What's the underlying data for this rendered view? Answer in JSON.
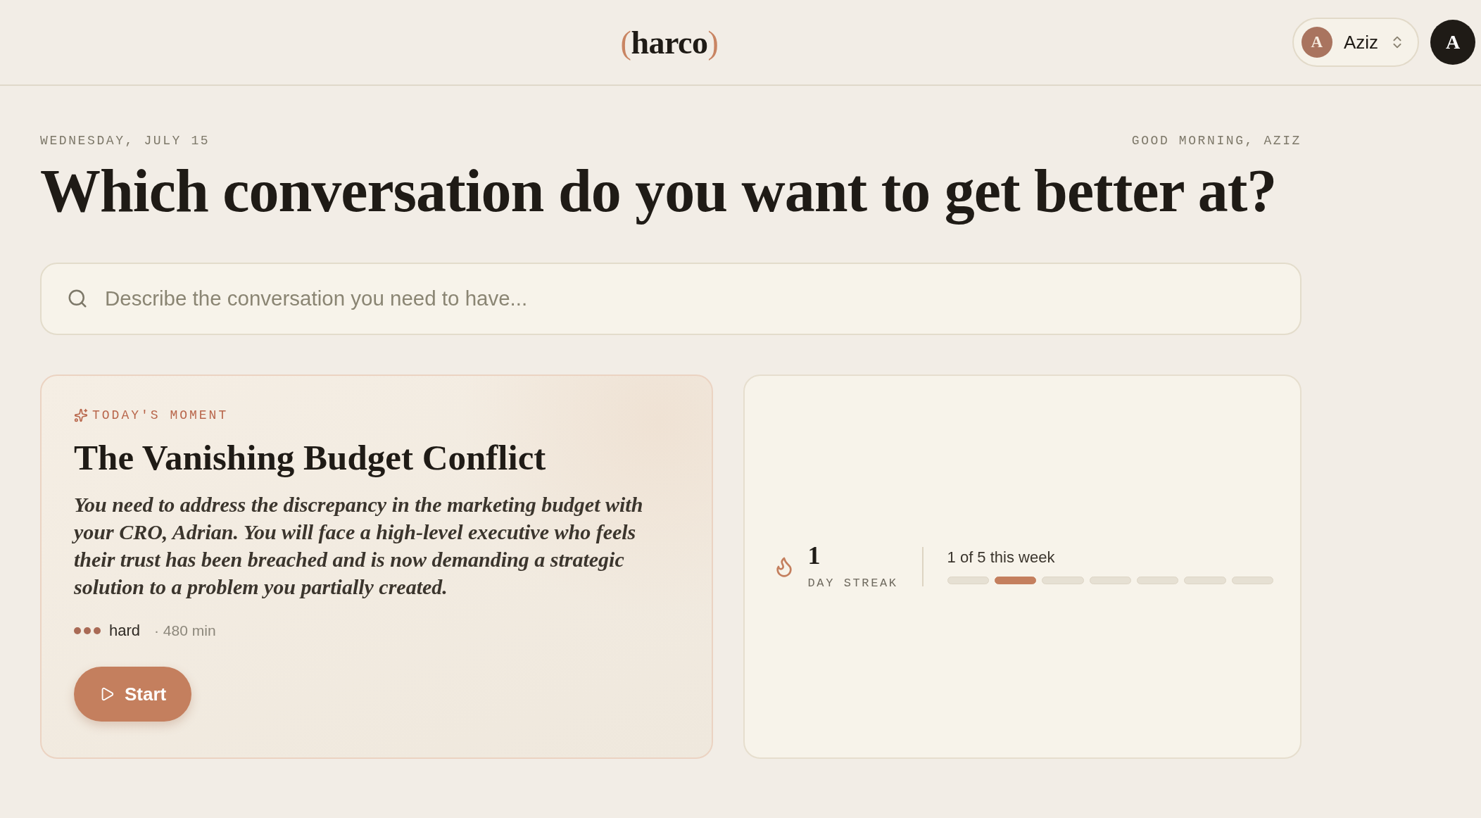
{
  "header": {
    "logo": {
      "open": "(",
      "word": "harco",
      "close": ")"
    },
    "user_switcher": {
      "initial": "A",
      "name": "Aziz"
    },
    "avatar": {
      "initial": "A"
    }
  },
  "intro": {
    "date": "WEDNESDAY, JULY 15",
    "greeting": "GOOD MORNING, AZIZ",
    "headline": "Which conversation do you want to get better at?"
  },
  "search": {
    "placeholder": "Describe the conversation you need to have..."
  },
  "moment": {
    "label": "TODAY'S MOMENT",
    "title": "The Vanishing Budget Conflict",
    "description": "You need to address the discrepancy in the marketing budget with your CRO, Adrian. You will face a high-level executive who feels their trust has been breached and is now demanding a strategic solution to a problem you partially created.",
    "difficulty": {
      "stars": 3,
      "label": "hard"
    },
    "duration": "· 480 min",
    "button": "Start"
  },
  "streak": {
    "count": "1",
    "label": "DAY STREAK",
    "progress": "1 of 5 this week",
    "days": [
      {
        "done": false
      },
      {
        "done": true
      },
      {
        "done": false
      },
      {
        "done": false
      },
      {
        "done": false
      },
      {
        "done": false
      },
      {
        "done": false
      }
    ]
  }
}
